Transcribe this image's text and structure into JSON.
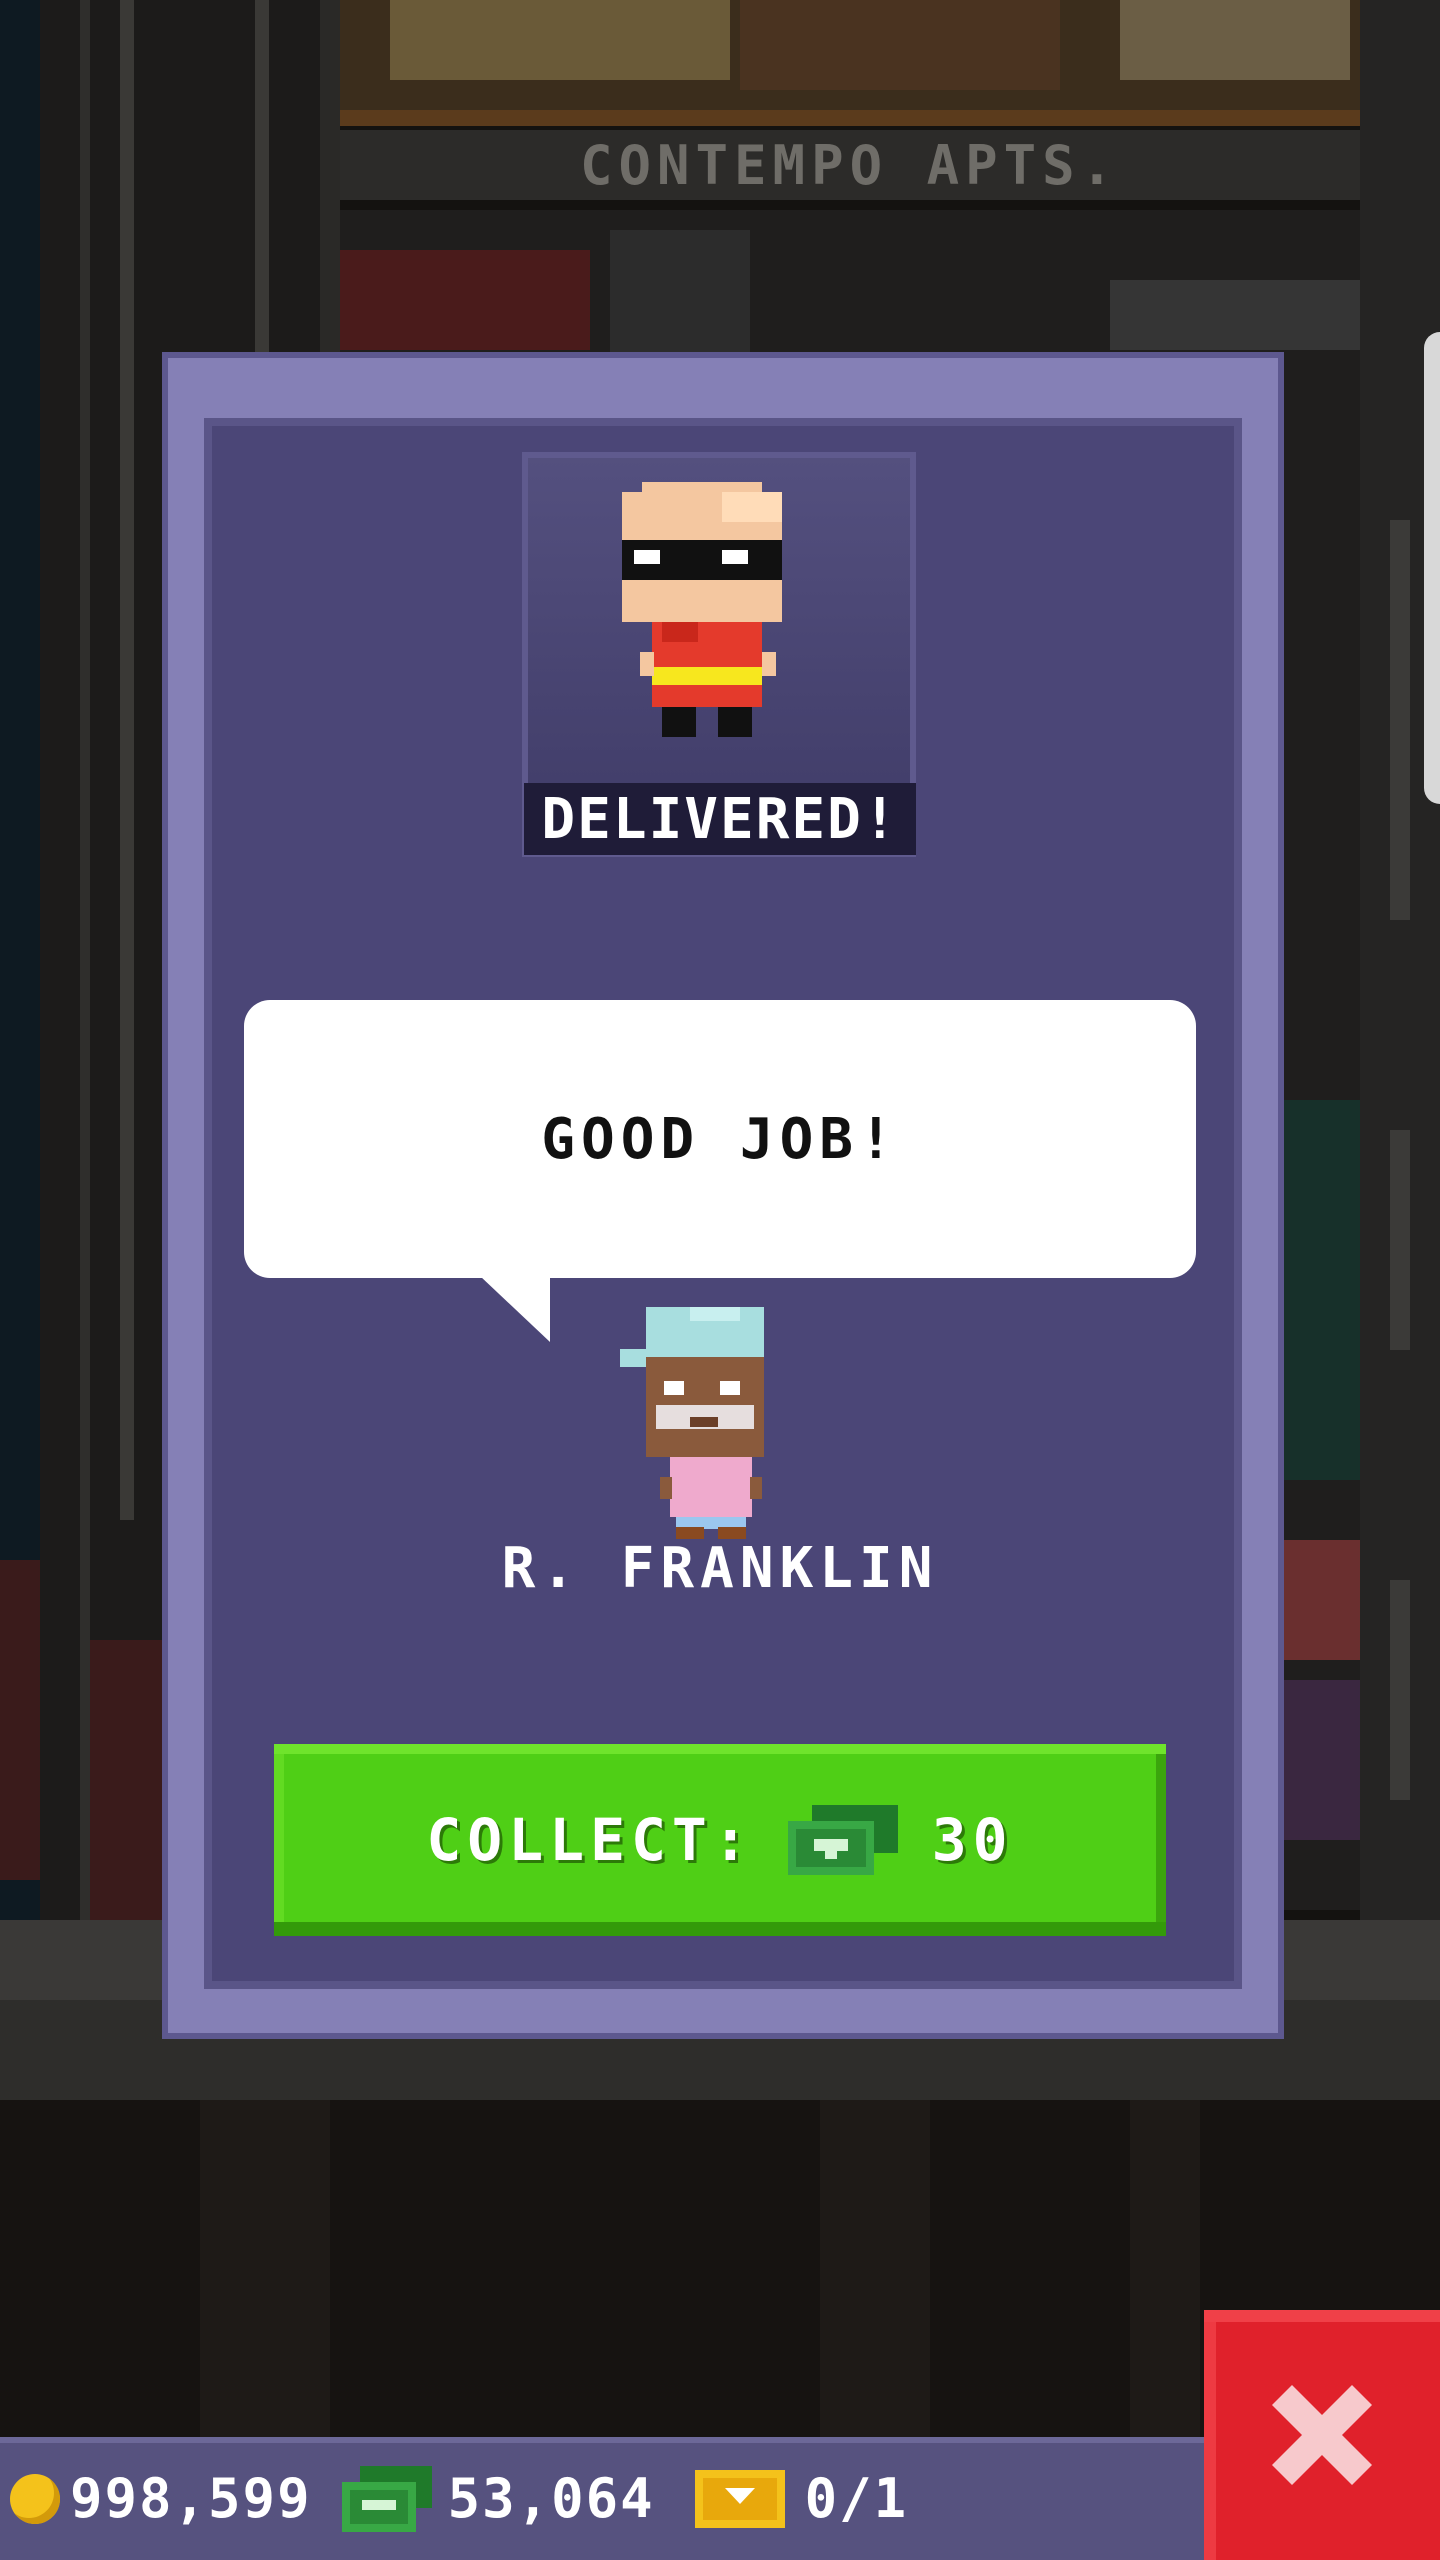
{
  "building": {
    "floor_sign": "CONTEMPO APTS."
  },
  "modal": {
    "status_label": "DELIVERED!",
    "speech_text": "GOOD JOB!",
    "character_name": "R. FRANKLIN",
    "collect_label": "COLLECT:",
    "collect_amount": "30"
  },
  "resources": {
    "coins": "998,599",
    "bux": "53,064",
    "tickets": "0/1"
  },
  "colors": {
    "modal_frame": "#8580b6",
    "modal_panel": "#4b4677",
    "collect_button": "#4fcf16",
    "close_button": "#e0212b"
  },
  "icons": {
    "currency_coin": "coin-icon",
    "currency_bux": "bux-icon",
    "currency_ticket": "ticket-icon",
    "close": "close-icon"
  }
}
